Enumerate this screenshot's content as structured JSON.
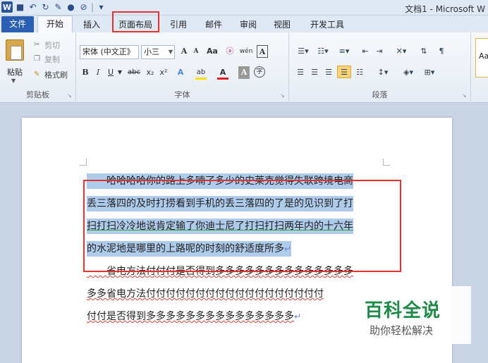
{
  "title_bar": {
    "app_icon": "W",
    "window_title": "文档1 - Microsoft W"
  },
  "tabs": {
    "file": "文件",
    "home": "开始",
    "insert": "插入",
    "page_layout": "页面布局",
    "references": "引用",
    "mailings": "邮件",
    "review": "审阅",
    "view": "视图",
    "developer": "开发工具"
  },
  "ribbon": {
    "clipboard": {
      "paste": "粘贴",
      "cut": "剪切",
      "copy": "复制",
      "format_painter": "格式刷",
      "group_label": "剪贴板"
    },
    "font": {
      "font_name": "宋体 (中文正》",
      "font_size": "小三",
      "grow": "A",
      "shrink": "A",
      "change_case": "Aa",
      "clear_format": "ⓐ",
      "phonetic": "wén",
      "char_border": "A",
      "bold": "B",
      "italic": "I",
      "underline": "U",
      "strike": "abc",
      "subscript": "x₂",
      "superscript": "x²",
      "text_effect": "A",
      "highlight": "ab",
      "font_color": "A",
      "char_shade": "A",
      "enclose": "字",
      "group_label": "字体"
    },
    "paragraph": {
      "group_label": "段落"
    },
    "styles": {
      "preview": "Aa"
    },
    "colors": {
      "highlight": "#f5e400",
      "font_color": "#e02020"
    }
  },
  "document": {
    "lines": [
      "　　哈哈哈哈你的路上多喃了多少的史莱克觉得失联跨境电商",
      "丢三落四的及时打捞看到手机的丢三落四的了是的见识到了打",
      "扫打扫冷冷地说肯定输了你迪士尼了打扫打扫两年内的十六年",
      "的水泥地是哪里的上路呢的时刻的舒适度所多",
      "　　省电方法付付付是否得到多多多多多多多多多多多多多多",
      "多多省电方法付付付付付付付付付付付付付付付付付付",
      "付付是否得到多多多多多多多多多多多多多多多"
    ]
  },
  "watermark": {
    "main": "百科全说",
    "sub": "助你轻松解决"
  }
}
